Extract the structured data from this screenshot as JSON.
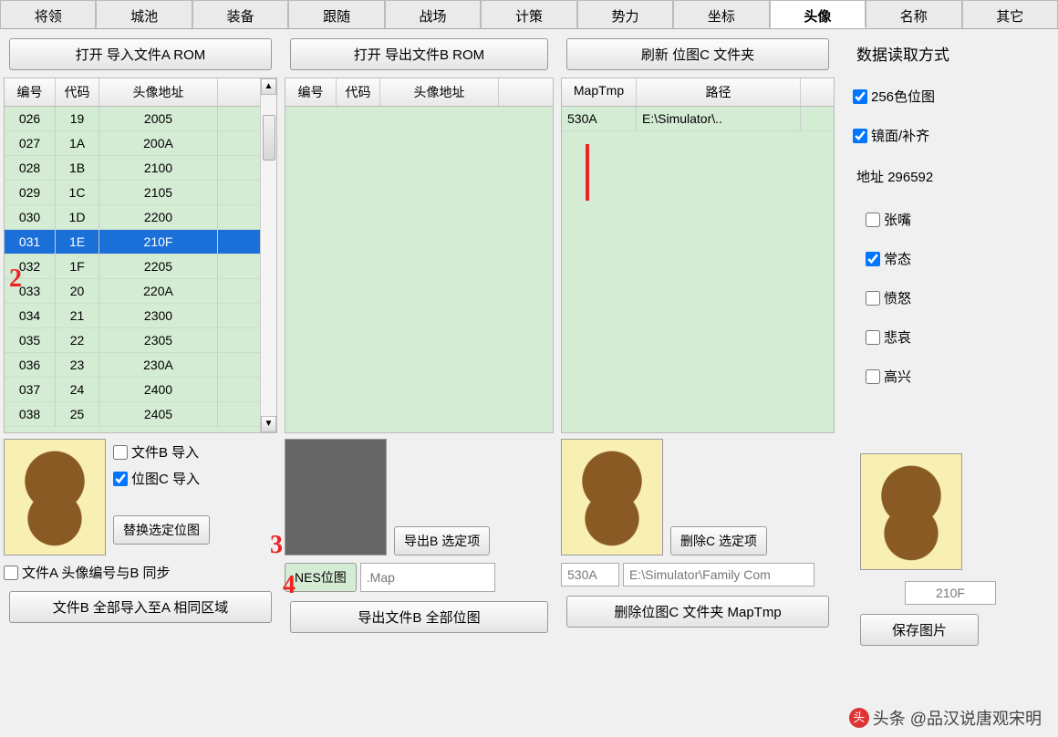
{
  "tabs": [
    "将领",
    "城池",
    "装备",
    "跟随",
    "战场",
    "计策",
    "势力",
    "坐标",
    "头像",
    "名称",
    "其它"
  ],
  "active_tab": "头像",
  "btn": {
    "open_a": "打开 导入文件A ROM",
    "open_b": "打开 导出文件B ROM",
    "refresh_c": "刷新 位图C 文件夹",
    "replace_sel": "替换选定位图",
    "export_b_sel": "导出B 选定项",
    "delete_c_sel": "删除C 选定项",
    "import_all_a": "文件B 全部导入至A 相同区域",
    "export_all_b": "导出文件B 全部位图",
    "delete_c_folder": "删除位图C 文件夹 MapTmp",
    "save_img": "保存图片",
    "nes": "NES位图"
  },
  "headers": {
    "num": "编号",
    "code": "代码",
    "addr": "头像地址",
    "maptmp": "MapTmp",
    "path": "路径"
  },
  "rows_a": [
    {
      "n": "026",
      "c": "19",
      "a": "2005"
    },
    {
      "n": "027",
      "c": "1A",
      "a": "200A"
    },
    {
      "n": "028",
      "c": "1B",
      "a": "2100"
    },
    {
      "n": "029",
      "c": "1C",
      "a": "2105"
    },
    {
      "n": "030",
      "c": "1D",
      "a": "2200"
    },
    {
      "n": "031",
      "c": "1E",
      "a": "210F"
    },
    {
      "n": "032",
      "c": "1F",
      "a": "2205"
    },
    {
      "n": "033",
      "c": "20",
      "a": "220A"
    },
    {
      "n": "034",
      "c": "21",
      "a": "2300"
    },
    {
      "n": "035",
      "c": "22",
      "a": "2305"
    },
    {
      "n": "036",
      "c": "23",
      "a": "230A"
    },
    {
      "n": "037",
      "c": "24",
      "a": "2400"
    },
    {
      "n": "038",
      "c": "25",
      "a": "2405"
    }
  ],
  "rows_c": [
    {
      "mt": "530A",
      "p": "E:\\Simulator\\.."
    }
  ],
  "chk": {
    "file_b_import": "文件B 导入",
    "bitmap_c_import": "位图C 导入",
    "sync_ab": "文件A 头像编号与B 同步"
  },
  "input": {
    "map_ext": ".Map",
    "c_code": "530A",
    "c_path": "E:\\Simulator\\Family Com",
    "d_code": "210F"
  },
  "panel_d": {
    "title": "数据读取方式",
    "c256": "256色位图",
    "mirror": "镜面/补齐",
    "addr_label": "地址",
    "addr_val": "296592",
    "o1": "张嘴",
    "o2": "常态",
    "o3": "愤怒",
    "o4": "悲哀",
    "o5": "高兴"
  },
  "annotations": {
    "n2": "2",
    "n3": "3",
    "n4": "4"
  },
  "watermark": "头条 @品汉说唐观宋明"
}
